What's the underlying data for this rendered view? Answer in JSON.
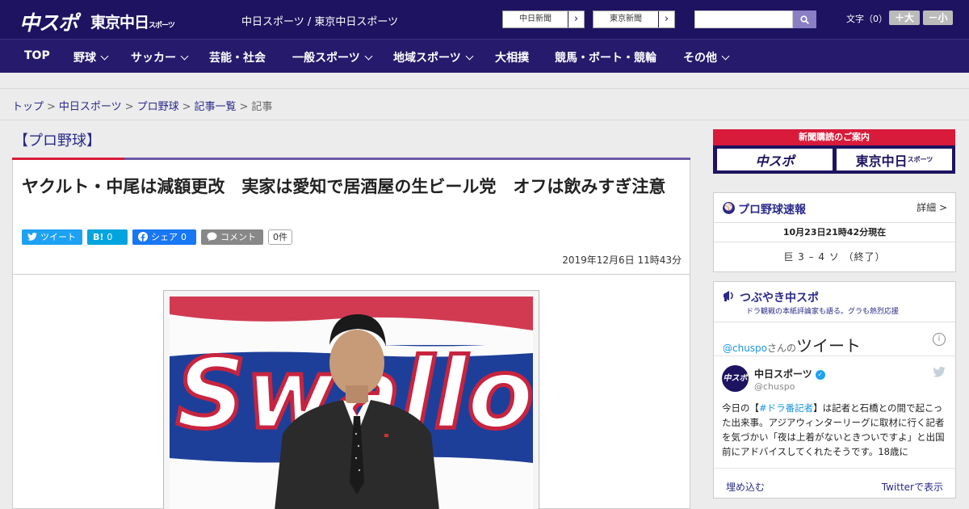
{
  "header": {
    "logo_chuspo": "中スポ",
    "logo_tokyo": "東京中日",
    "logo_tokyo_small": "スポーツ",
    "site_title": "中日スポーツ / 東京中日スポーツ",
    "ext_links": [
      "中日新聞",
      "東京新聞"
    ],
    "search_placeholder": "",
    "font_size_label": "文字（0）",
    "font_plus": "＋大",
    "font_minus": "－小",
    "colors": {
      "header_bg": "#1d1360",
      "nav_bg": "#261a6c",
      "accent_red": "#d81b3a"
    }
  },
  "nav": {
    "items": [
      {
        "label": "TOP",
        "has_dropdown": false
      },
      {
        "label": "野球",
        "has_dropdown": true
      },
      {
        "label": "サッカー",
        "has_dropdown": true
      },
      {
        "label": "芸能・社会",
        "has_dropdown": false
      },
      {
        "label": "一般スポーツ",
        "has_dropdown": true
      },
      {
        "label": "地域スポーツ",
        "has_dropdown": true
      },
      {
        "label": "大相撲",
        "has_dropdown": false
      },
      {
        "label": "競馬・ボート・競輪",
        "has_dropdown": false
      },
      {
        "label": "その他",
        "has_dropdown": true
      }
    ]
  },
  "breadcrumb": {
    "links": [
      "トップ",
      "中日スポーツ",
      "プロ野球",
      "記事一覧"
    ],
    "current": "記事",
    "separator": ">"
  },
  "article": {
    "category": "【プロ野球】",
    "headline": "ヤクルト・中尾は減額更改　実家は愛知で居酒屋の生ビール党　オフは飲みすぎ注意",
    "share": {
      "tweet": "ツイート",
      "hatena_label": "B!",
      "hatena_count": "0",
      "facebook": "シェア",
      "facebook_count": "0",
      "comment": "コメント",
      "comment_count": "0件"
    },
    "date": "2019年12月6日 11時43分",
    "photo_backdrop_text": "Swallo"
  },
  "sidebar": {
    "subscription": {
      "title": "新聞購読のご案内",
      "logo_left": "中スポ",
      "logo_right": "東京中日",
      "logo_right_small": "スポーツ"
    },
    "baseball": {
      "title": "プロ野球速報",
      "detail": "詳細 >",
      "timestamp": "10月23日21時42分現在",
      "score": "巨 3 – 4 ソ （終了）"
    },
    "tweets": {
      "title": "つぶやき中スポ",
      "subtitle": "ドラ観戦の本紙評論家も語る。グラも熱烈応援",
      "handle": "@chuspo",
      "handle_suffix": "さんの",
      "heading": "ツイート",
      "account_name": "中日スポーツ",
      "account_screen": "@chuspo",
      "avatar_text": "中スポ",
      "text_before": "今日の【",
      "hashtag": "#ドラ番記者",
      "text_after": "】は記者と石橋との間で起こった出来事。アジアウィンターリーグに取材に行く記者を気づかい「夜は上着がないときついですよ」と出国前にアドバイスしてくれたそうです。18歳に",
      "embed": "埋め込む",
      "view_on_twitter": "Twitterで表示"
    }
  }
}
